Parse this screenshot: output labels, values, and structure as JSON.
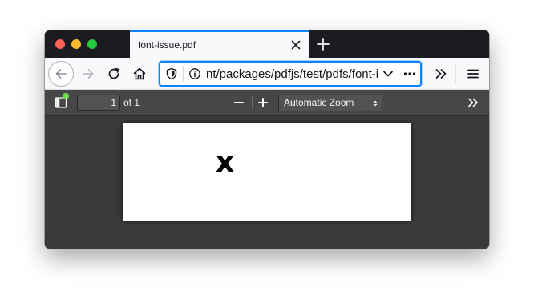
{
  "window": {
    "tab": {
      "title": "font-issue.pdf"
    }
  },
  "navbar": {
    "url": "nt/packages/pdfjs/test/pdfs/font-issue.pdf"
  },
  "pdf_toolbar": {
    "page_number": "1",
    "page_of": "of 1",
    "zoom": "Automatic Zoom"
  },
  "document": {
    "glyph": "x"
  },
  "colors": {
    "accent": "#0a84ff",
    "toolbar": "#474749",
    "viewer_bg": "#3a3a3d",
    "notification_dot": "#70db55"
  },
  "icons": {
    "tab_close": "close-icon",
    "new_tab": "plus-icon",
    "back": "arrow-left-icon",
    "forward": "arrow-right-icon",
    "reload": "reload-icon",
    "home": "home-icon",
    "shield": "shield-icon",
    "info": "info-icon",
    "dropdown": "chevron-down-icon",
    "more": "ellipsis-icon",
    "overflow": "double-chevron-right-icon",
    "menu": "hamburger-icon",
    "sidebar": "sidebar-toggle-icon",
    "zoom_out": "minus-icon",
    "zoom_in": "plus-icon",
    "tools": "double-chevron-right-icon"
  }
}
